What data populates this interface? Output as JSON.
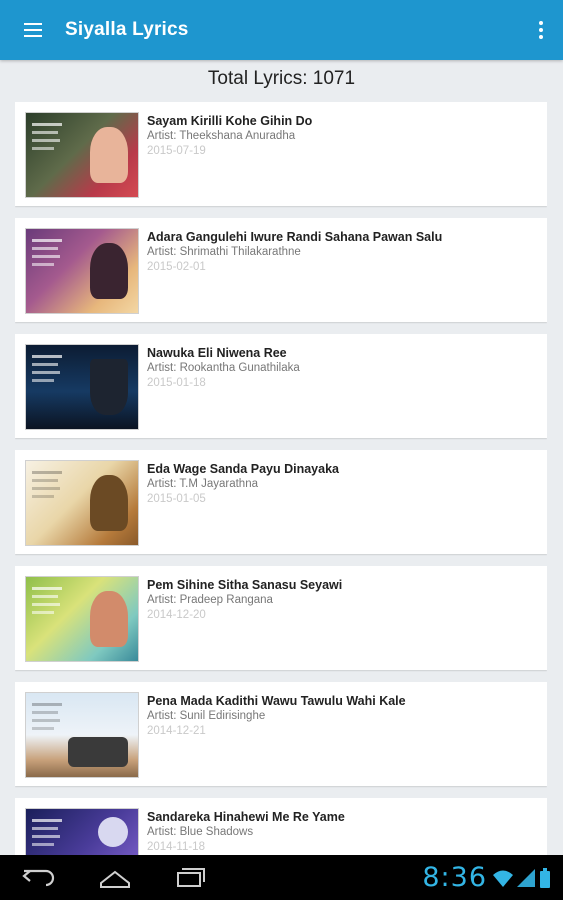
{
  "app": {
    "title": "Siyalla Lyrics",
    "menu_icon": "hamburger-menu-icon",
    "overflow_icon": "more-vertical-icon",
    "accent_color": "#1e96cf"
  },
  "summary": {
    "total_label": "Total Lyrics: 1071"
  },
  "songs": [
    {
      "title": "Sayam Kirilli Kohe Gihin Do",
      "artist": "Artist: Theekshana Anuradha",
      "date": "2015-07-19"
    },
    {
      "title": "Adara Gangulehi Iwure Randi Sahana Pawan Salu",
      "artist": "Artist: Shrimathi Thilakarathne",
      "date": "2015-02-01"
    },
    {
      "title": "Nawuka Eli Niwena Ree",
      "artist": "Artist: Rookantha Gunathilaka",
      "date": "2015-01-18"
    },
    {
      "title": "Eda Wage Sanda Payu Dinayaka",
      "artist": "Artist: T.M Jayarathna",
      "date": "2015-01-05"
    },
    {
      "title": "Pem Sihine Sitha Sanasu Seyawi",
      "artist": "Artist: Pradeep Rangana",
      "date": "2014-12-20"
    },
    {
      "title": "Pena Mada Kadithi Wawu Tawulu Wahi Kale",
      "artist": "Artist: Sunil Edirisinghe",
      "date": "2014-12-21"
    },
    {
      "title": "Sandareka Hinahewi Me Re Yame",
      "artist": "Artist: Blue Shadows",
      "date": "2014-11-18"
    }
  ],
  "system": {
    "clock": "8:36",
    "clock_color": "#33b5e5",
    "back_icon": "back-icon",
    "home_icon": "home-icon",
    "recents_icon": "recent-apps-icon",
    "wifi_icon": "wifi-icon",
    "signal_icon": "signal-icon",
    "battery_icon": "battery-icon"
  }
}
